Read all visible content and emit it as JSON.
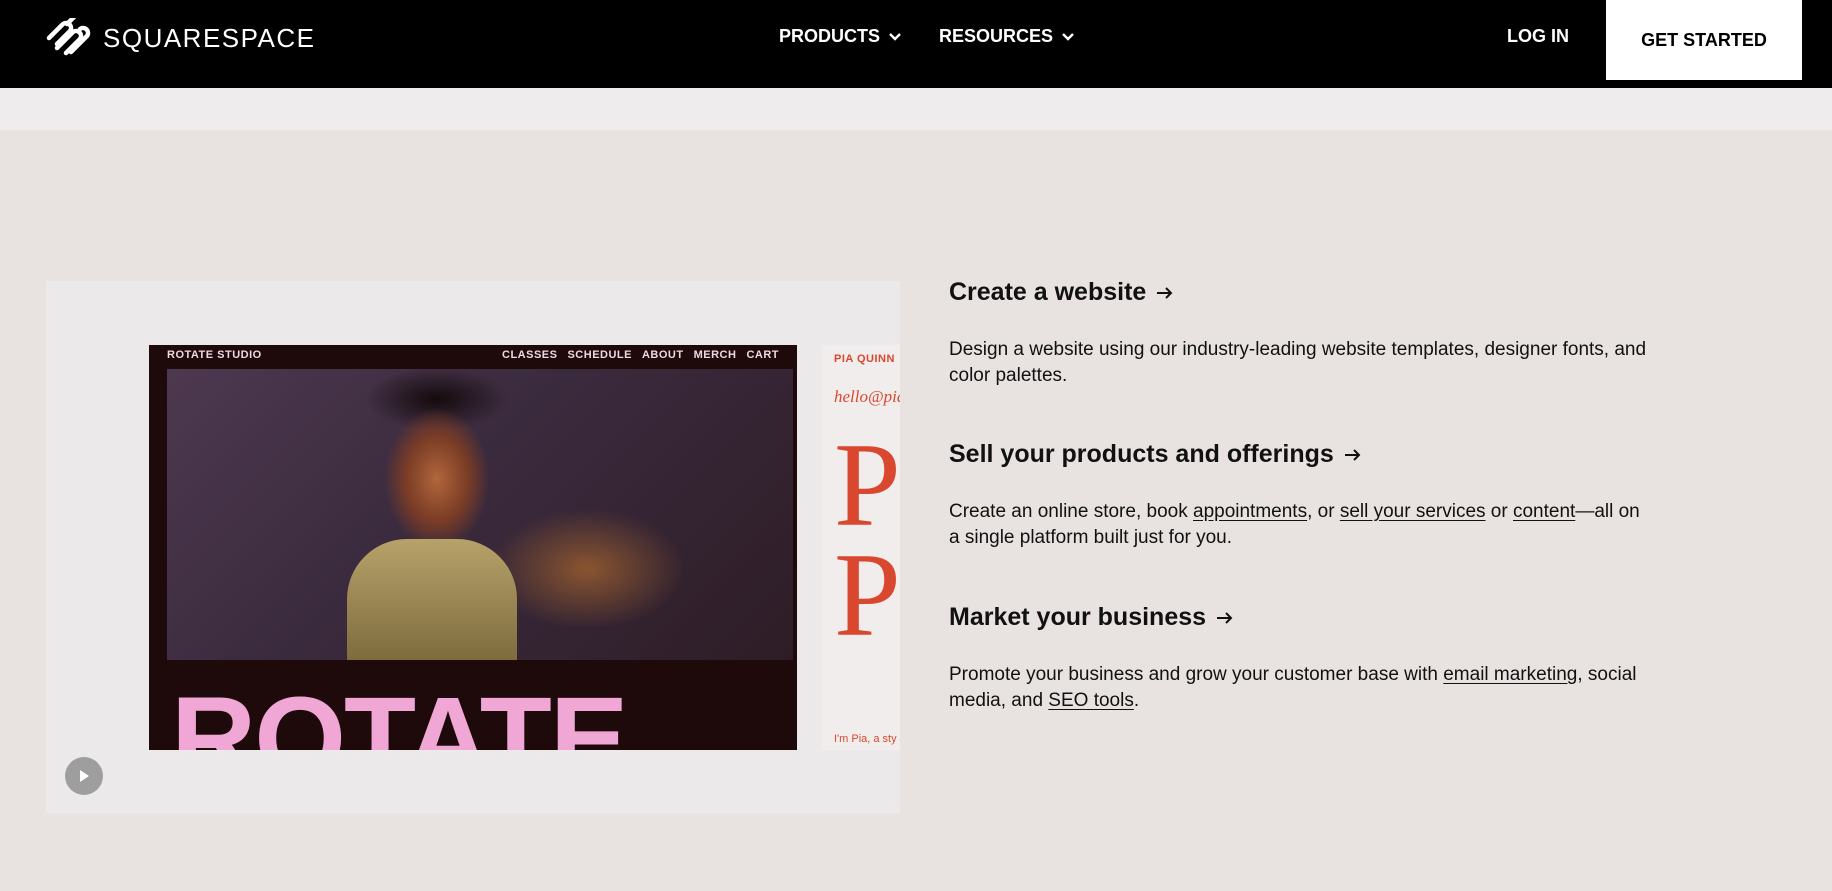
{
  "header": {
    "brand": "SQUARESPACE",
    "nav": [
      {
        "label": "PRODUCTS"
      },
      {
        "label": "RESOURCES"
      }
    ],
    "login_label": "LOG IN",
    "cta_label": "GET STARTED"
  },
  "media": {
    "site_preview": {
      "brand": "ROTATE STUDIO",
      "menu": [
        "CLASSES",
        "SCHEDULE",
        "ABOUT",
        "MERCH",
        "CART"
      ],
      "headline": "ROTATE"
    },
    "second_preview": {
      "name": "PIA QUINN",
      "email": "hello@pia-",
      "big_letter": "P",
      "footer": "I'm Pia, a sty"
    },
    "play_icon": "play-icon"
  },
  "features": [
    {
      "title": "Create a website",
      "desc_text": "Design a website using our industry-leading website templates, designer fonts, and color palettes."
    },
    {
      "title": "Sell your products and offerings",
      "desc_parts": {
        "t1": "Create an online store, book ",
        "l1": "appointments",
        "t2": ", or ",
        "l2": "sell your services",
        "t3": " or ",
        "l3": "content",
        "t4": "—all on a single platform built just for you."
      }
    },
    {
      "title": "Market your business",
      "desc_parts": {
        "t1": "Promote your business and grow your customer base with ",
        "l1": "email marketing",
        "t2": ", social media, and ",
        "l2": "SEO tools",
        "t3": "."
      }
    }
  ]
}
